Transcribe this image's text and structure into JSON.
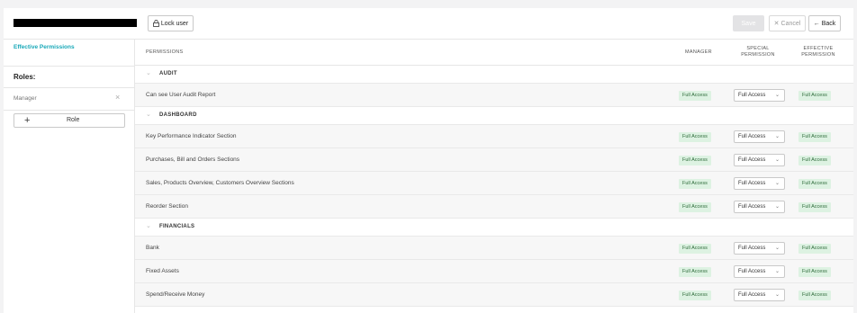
{
  "toolbar": {
    "lock_label": "Lock user",
    "save_label": "Save",
    "cancel_label": "Cancel",
    "back_label": "Back"
  },
  "sidebar": {
    "active_label": "Effective Permissions",
    "roles_title": "Roles:",
    "roles": [
      {
        "name": "Manager"
      }
    ],
    "add_role_label": "Role"
  },
  "table": {
    "headers": {
      "permissions": "PERMISSIONS",
      "manager": "MANAGER",
      "special": [
        "SPECIAL",
        "PERMISSION"
      ],
      "effective": [
        "EFFECTIVE",
        "PERMISSION"
      ]
    },
    "sections": [
      {
        "title": "AUDIT",
        "items": [
          {
            "label": "Can see User Audit Report",
            "manager": "Full Access",
            "special": "Full Access",
            "effective": "Full Access"
          }
        ]
      },
      {
        "title": "DASHBOARD",
        "items": [
          {
            "label": "Key Performance Indicator Section",
            "manager": "Full Access",
            "special": "Full Access",
            "effective": "Full Access"
          },
          {
            "label": "Purchases, Bill and Orders Sections",
            "manager": "Full Access",
            "special": "Full Access",
            "effective": "Full Access"
          },
          {
            "label": "Sales, Products Overview, Customers Overview Sections",
            "manager": "Full Access",
            "special": "Full Access",
            "effective": "Full Access"
          },
          {
            "label": "Reorder Section",
            "manager": "Full Access",
            "special": "Full Access",
            "effective": "Full Access"
          }
        ]
      },
      {
        "title": "FINANCIALS",
        "items": [
          {
            "label": "Bank",
            "manager": "Full Access",
            "special": "Full Access",
            "effective": "Full Access"
          },
          {
            "label": "Fixed Assets",
            "manager": "Full Access",
            "special": "Full Access",
            "effective": "Full Access"
          },
          {
            "label": "Spend/Receive Money",
            "manager": "Full Access",
            "special": "Full Access",
            "effective": "Full Access"
          }
        ]
      }
    ]
  },
  "colors": {
    "accent": "#18a8b8",
    "badge_bg": "#ddf2e2",
    "badge_text": "#2e6b3a"
  }
}
